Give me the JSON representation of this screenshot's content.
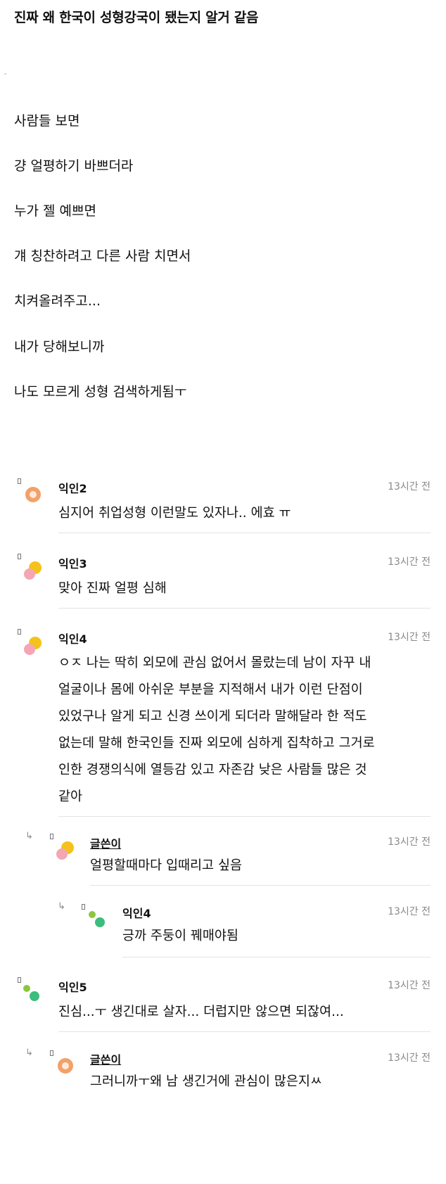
{
  "post": {
    "title": "진짜 왜 한국이 성형강국이 됐는지 알거 같음",
    "lines": [
      "사람들 보면",
      "걍 얼평하기 바쁘더라",
      "누가 젤 예쁘면",
      "걔 칭찬하려고 다른 사람 치면서",
      "치켜올려주고...",
      "내가 당해보니까",
      "나도 모르게 성형 검색하게됨ㅜ"
    ]
  },
  "comments": [
    {
      "author": "익인2",
      "time": "13시간 전",
      "text": "심지어 취업성형 이런말도 있자나.. 에효 ㅠ",
      "avatar": "orange-circle-avatar"
    },
    {
      "author": "익인3",
      "time": "13시간 전",
      "text": "맞아 진짜 얼평 심해",
      "avatar": "yellow-pink-avatar"
    },
    {
      "author": "익인4",
      "time": "13시간 전",
      "text_lines": [
        "ㅇㅈ 나는 딱히 외모에 관심 없어서 몰랐는데 남이 자꾸 내",
        "얼굴이나 몸에 아쉬운 부분을 지적해서 내가 이런 단점이",
        "있었구나 알게 되고 신경 쓰이게 되더라 말해달라 한 적도",
        "없는데 말해 한국인들 진짜 외모에 심하게 집착하고 그거로",
        "인한 경쟁의식에 열등감 있고 자존감 낮은 사람들 많은 것",
        "같아"
      ],
      "avatar": "yellow-pink-avatar"
    },
    {
      "author": "글쓴이",
      "time": "13시간 전",
      "text": "얼평할때마다 입때리고 싶음",
      "avatar": "yellow-pink-avatar",
      "reply": true
    },
    {
      "author": "익인4",
      "time": "13시간 전",
      "text": "긍까 주둥이 꿰매야됨",
      "avatar": "green-dots-avatar",
      "reply": true
    },
    {
      "author": "익인5",
      "time": "13시간 전",
      "text": "진심...ㅜ 생긴대로 살자... 더럽지만 않으면 되잖여...",
      "avatar": "green-dots-avatar"
    },
    {
      "author": "글쓴이",
      "time": "13시간 전",
      "text": "그러니까ㅜ왜 남 생긴거에 관심이 많은지ㅆ",
      "avatar": "orange-circle-avatar",
      "reply": true
    }
  ],
  "colors": {
    "text": "#111111",
    "muted": "#8a8a8a",
    "divider": "#e3e3e3",
    "orange": "#f2a16a",
    "yellow": "#f5c21b",
    "pink": "#f4a6b4",
    "lime": "#8cc63f",
    "green": "#3dbd7d"
  }
}
